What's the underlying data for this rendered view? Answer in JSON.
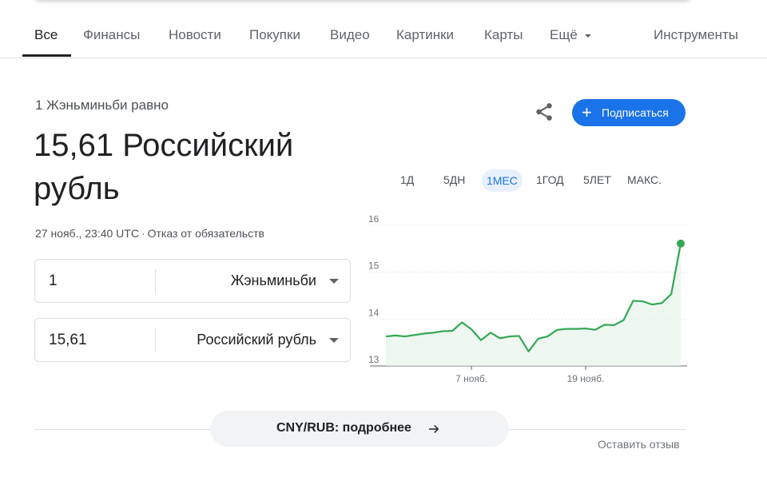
{
  "tabs": [
    {
      "label": "Все",
      "active": true
    },
    {
      "label": "Финансы"
    },
    {
      "label": "Новости"
    },
    {
      "label": "Покупки"
    },
    {
      "label": "Видео"
    },
    {
      "label": "Картинки"
    },
    {
      "label": "Карты"
    },
    {
      "label": "Ещё",
      "has_dropdown": true
    }
  ],
  "tools_label": "Инструменты",
  "header": {
    "subtitle": "1 Жэньминьби равно",
    "result_line": "15,61 Российский рубль",
    "timestamp": "27 нояб., 23:40 UTC",
    "separator": "·",
    "disclaimer": "Отказ от обязательств"
  },
  "actions": {
    "share_icon": "share-icon",
    "subscribe_label": "Подписаться",
    "subscribe_plus": "+"
  },
  "converter": {
    "from": {
      "amount": "1",
      "currency": "Жэньминьби"
    },
    "to": {
      "amount": "15,61",
      "currency": "Российский рубль"
    }
  },
  "ranges": [
    {
      "label": "1Д"
    },
    {
      "label": "5ДН"
    },
    {
      "label": "1МЕС",
      "active": true
    },
    {
      "label": "1ГОД"
    },
    {
      "label": "5ЛЕТ"
    },
    {
      "label": "МАКС."
    }
  ],
  "colors": {
    "accent": "#1a73e8",
    "line": "#34a853",
    "area": "#e6f4ea"
  },
  "chart_data": {
    "type": "area",
    "y_ticks": [
      "16",
      "15",
      "14",
      "13"
    ],
    "x_tick_labels": [
      "7 нояб.",
      "19 нояб."
    ],
    "ylim": [
      13,
      16
    ],
    "x_ticks_at": [
      9,
      21
    ],
    "values": [
      13.63,
      13.65,
      13.63,
      13.66,
      13.69,
      13.71,
      13.74,
      13.75,
      13.93,
      13.78,
      13.55,
      13.71,
      13.59,
      13.63,
      13.64,
      13.31,
      13.58,
      13.63,
      13.77,
      13.79,
      13.79,
      13.8,
      13.77,
      13.88,
      13.87,
      13.98,
      14.39,
      14.38,
      14.31,
      14.34,
      14.53,
      15.61
    ],
    "last_point_marker": true,
    "grid": true
  },
  "footer": {
    "details_label": "CNY/RUB: подробнее",
    "feedback_label": "Оставить отзыв"
  }
}
